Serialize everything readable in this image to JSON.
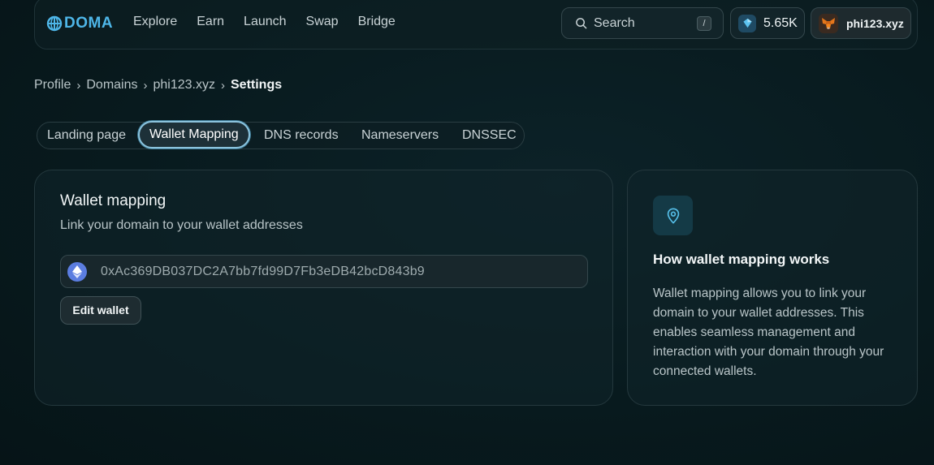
{
  "brand": {
    "name": "DOMA",
    "color": "#4eb6e8"
  },
  "nav": {
    "links": [
      "Explore",
      "Earn",
      "Launch",
      "Swap",
      "Bridge"
    ],
    "search_placeholder": "Search",
    "search_shortcut": "/",
    "balance": "5.65K",
    "account": "phi123.xyz"
  },
  "breadcrumb": {
    "items": [
      "Profile",
      "Domains",
      "phi123.xyz"
    ],
    "current": "Settings"
  },
  "tabs": {
    "items": [
      "Landing page",
      "Wallet Mapping",
      "DNS records",
      "Nameservers",
      "DNSSEC"
    ],
    "active": "Wallet Mapping"
  },
  "wallet_card": {
    "title": "Wallet mapping",
    "subtitle": "Link your domain to your wallet addresses",
    "address": "0xAc369DB037DC2A7bb7fd99D7Fb3eDB42bcD843b9",
    "address_icon": "ethereum-icon",
    "edit_label": "Edit wallet"
  },
  "info_card": {
    "icon": "location-pin-icon",
    "title": "How wallet mapping works",
    "body": "Wallet mapping allows you to link your domain to your wallet addresses. This enables seamless management and interaction with your domain through your connected wallets."
  }
}
